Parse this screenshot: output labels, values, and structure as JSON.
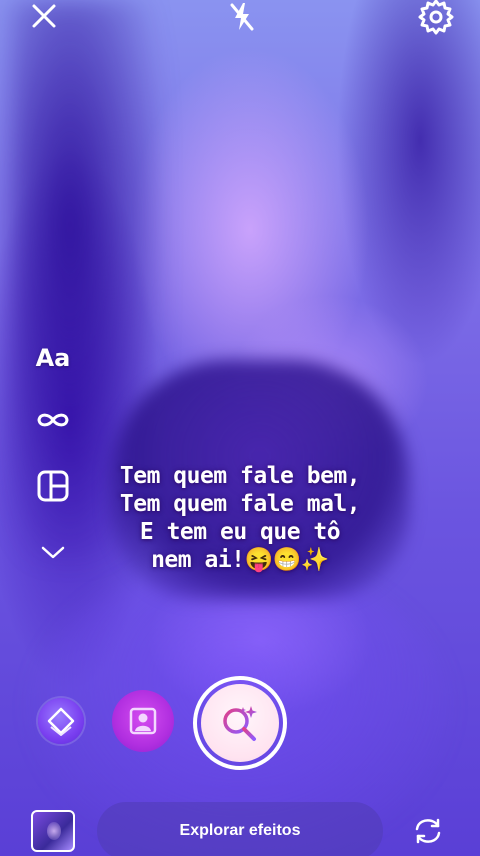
{
  "top_bar": {
    "close_icon": "close-icon",
    "flash_icon": "flash-off-icon",
    "settings_icon": "gear-icon"
  },
  "left_tools": {
    "text_tool_label": "Aa",
    "boomerang_icon": "infinity-icon",
    "layout_icon": "layout-grid-icon",
    "more_icon": "chevron-down-icon"
  },
  "caption": {
    "lines": [
      "Tem quem fale bem,",
      "Tem quem fale mal,",
      "E tem eu que tô",
      "nem ai!😝😁✨"
    ]
  },
  "effects": {
    "items": [
      "layers-effect-icon",
      "portrait-effect-icon"
    ],
    "capture_icon": "search-sparkle-icon"
  },
  "bottom_bar": {
    "explore_label": "Explorar efeitos",
    "flip_icon": "camera-flip-icon"
  },
  "colors": {
    "accent": "#b12fe0",
    "capture_ring": "#ffffff",
    "capture_icon_gradient_start": "#e0408a",
    "capture_icon_gradient_end": "#8f5bff"
  }
}
